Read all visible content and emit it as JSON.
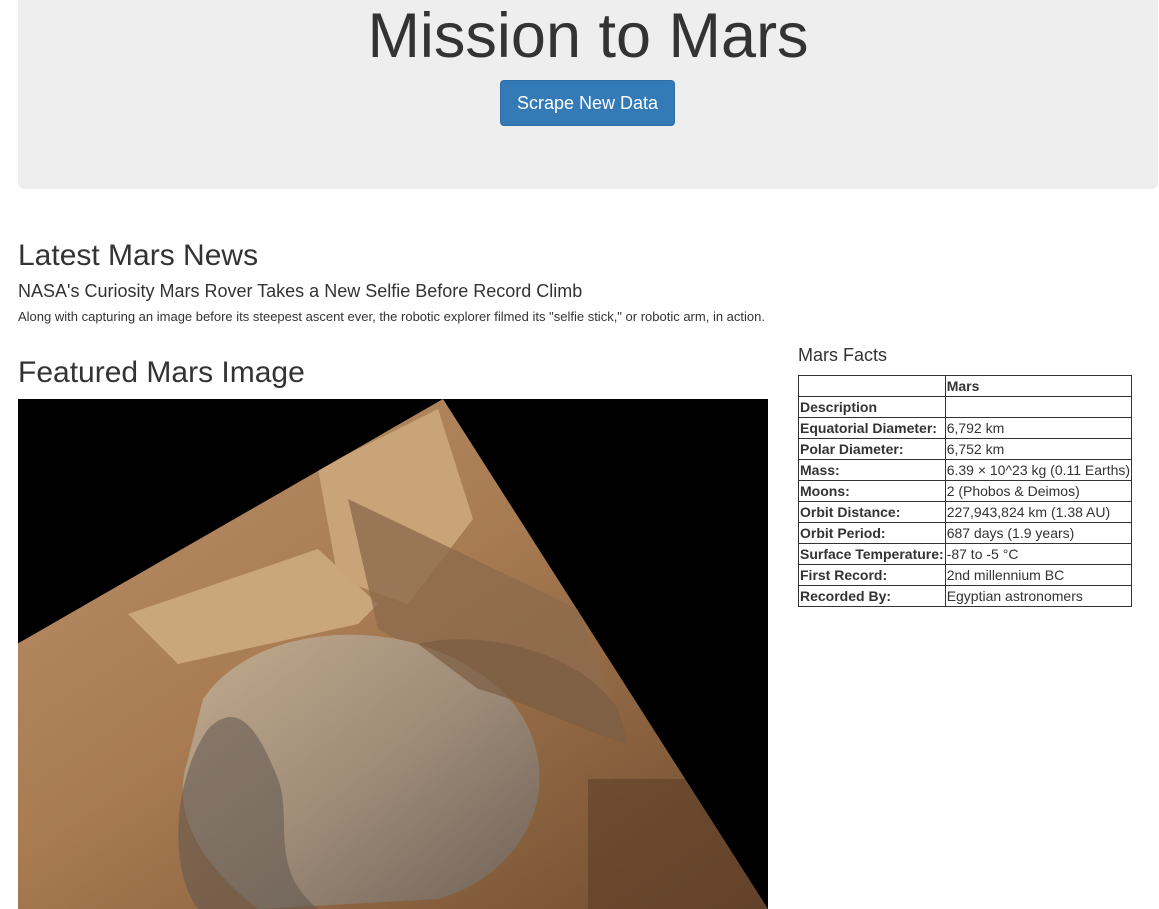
{
  "header": {
    "title": "Mission to Mars",
    "scrape_button_label": "Scrape New Data"
  },
  "news": {
    "heading": "Latest Mars News",
    "title": "NASA's Curiosity Mars Rover Takes a New Selfie Before Record Climb",
    "teaser": "Along with capturing an image before its steepest ascent ever, the robotic explorer filmed its \"selfie stick,\" or robotic arm, in action."
  },
  "featured": {
    "heading": "Featured Mars Image"
  },
  "facts": {
    "heading": "Mars Facts",
    "header_row": [
      "",
      "Mars"
    ],
    "rows": [
      {
        "label": "Description",
        "value": ""
      },
      {
        "label": "Equatorial Diameter:",
        "value": "6,792 km"
      },
      {
        "label": "Polar Diameter:",
        "value": "6,752 km"
      },
      {
        "label": "Mass:",
        "value": "6.39 × 10^23 kg (0.11 Earths)"
      },
      {
        "label": "Moons:",
        "value": "2 (Phobos & Deimos)"
      },
      {
        "label": "Orbit Distance:",
        "value": "227,943,824 km (1.38 AU)"
      },
      {
        "label": "Orbit Period:",
        "value": "687 days (1.9 years)"
      },
      {
        "label": "Surface Temperature:",
        "value": "-87 to -5 °C"
      },
      {
        "label": "First Record:",
        "value": "2nd millennium BC"
      },
      {
        "label": "Recorded By:",
        "value": "Egyptian astronomers"
      }
    ]
  }
}
